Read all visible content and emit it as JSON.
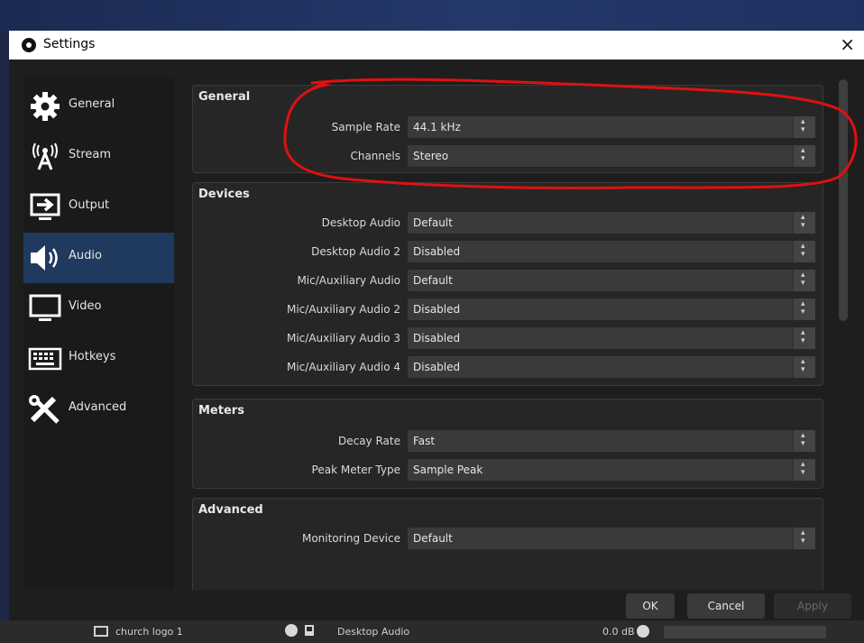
{
  "window": {
    "title": "Settings",
    "close_glyph": "×"
  },
  "sidebar": {
    "items": [
      {
        "label": "General",
        "icon": "gear-icon"
      },
      {
        "label": "Stream",
        "icon": "broadcast-icon"
      },
      {
        "label": "Output",
        "icon": "output-icon"
      },
      {
        "label": "Audio",
        "icon": "speaker-icon",
        "active": true
      },
      {
        "label": "Video",
        "icon": "monitor-icon"
      },
      {
        "label": "Hotkeys",
        "icon": "keyboard-icon"
      },
      {
        "label": "Advanced",
        "icon": "tools-icon"
      }
    ]
  },
  "groups": {
    "general": {
      "title": "General",
      "rows": [
        {
          "label": "Sample Rate",
          "value": "44.1 kHz"
        },
        {
          "label": "Channels",
          "value": "Stereo"
        }
      ]
    },
    "devices": {
      "title": "Devices",
      "rows": [
        {
          "label": "Desktop Audio",
          "value": "Default"
        },
        {
          "label": "Desktop Audio 2",
          "value": "Disabled"
        },
        {
          "label": "Mic/Auxiliary Audio",
          "value": "Default"
        },
        {
          "label": "Mic/Auxiliary Audio 2",
          "value": "Disabled"
        },
        {
          "label": "Mic/Auxiliary Audio 3",
          "value": "Disabled"
        },
        {
          "label": "Mic/Auxiliary Audio 4",
          "value": "Disabled"
        }
      ]
    },
    "meters": {
      "title": "Meters",
      "rows": [
        {
          "label": "Decay Rate",
          "value": "Fast"
        },
        {
          "label": "Peak Meter Type",
          "value": "Sample Peak"
        }
      ]
    },
    "advanced": {
      "title": "Advanced",
      "rows": [
        {
          "label": "Monitoring Device",
          "value": "Default"
        }
      ]
    }
  },
  "buttons": {
    "ok": "OK",
    "cancel": "Cancel",
    "apply": "Apply"
  },
  "background": {
    "source_name": "church logo 1",
    "mixer_source": "Desktop Audio",
    "level": "0.0 dB"
  },
  "colors": {
    "active_nav": "#1f3a5e",
    "annotation": "#e01010",
    "panel": "#262626"
  }
}
